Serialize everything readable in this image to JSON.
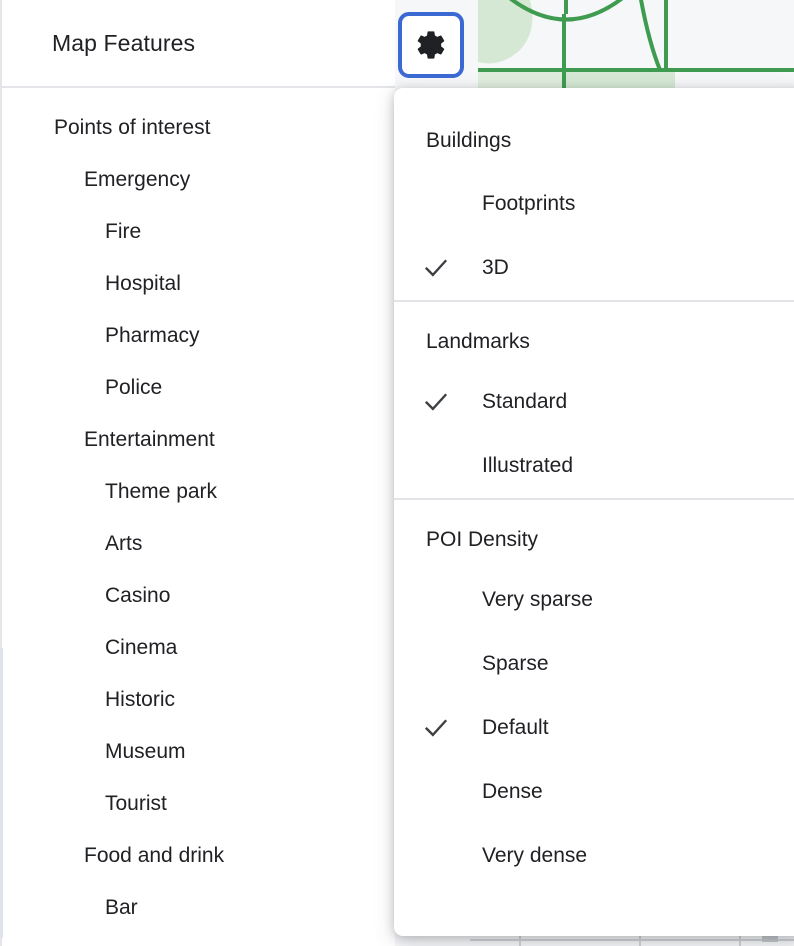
{
  "panel": {
    "title": "Map Features",
    "tree": [
      {
        "label": "Points of interest",
        "level": 0
      },
      {
        "label": "Emergency",
        "level": 1
      },
      {
        "label": "Fire",
        "level": 2
      },
      {
        "label": "Hospital",
        "level": 2
      },
      {
        "label": "Pharmacy",
        "level": 2
      },
      {
        "label": "Police",
        "level": 2
      },
      {
        "label": "Entertainment",
        "level": 1
      },
      {
        "label": "Theme park",
        "level": 2
      },
      {
        "label": "Arts",
        "level": 2
      },
      {
        "label": "Casino",
        "level": 2
      },
      {
        "label": "Cinema",
        "level": 2
      },
      {
        "label": "Historic",
        "level": 2
      },
      {
        "label": "Museum",
        "level": 2
      },
      {
        "label": "Tourist",
        "level": 2
      },
      {
        "label": "Food and drink",
        "level": 1
      },
      {
        "label": "Bar",
        "level": 2
      }
    ]
  },
  "settings_button": {
    "icon": "gear-icon",
    "focus_ring_color": "#3b69d4"
  },
  "menu": {
    "sections": [
      {
        "title": "Buildings",
        "items": [
          {
            "label": "Footprints",
            "checked": false
          },
          {
            "label": "3D",
            "checked": true
          }
        ]
      },
      {
        "title": "Landmarks",
        "items": [
          {
            "label": "Standard",
            "checked": true
          },
          {
            "label": "Illustrated",
            "checked": false
          }
        ]
      },
      {
        "title": "POI Density",
        "items": [
          {
            "label": "Very sparse",
            "checked": false
          },
          {
            "label": "Sparse",
            "checked": false
          },
          {
            "label": "Default",
            "checked": true
          },
          {
            "label": "Dense",
            "checked": false
          },
          {
            "label": "Very dense",
            "checked": false
          }
        ]
      }
    ]
  },
  "map": {
    "background_color": "#f6f7f9",
    "road_color": "#3f9b4f",
    "park_color": "#d5e8d4"
  }
}
